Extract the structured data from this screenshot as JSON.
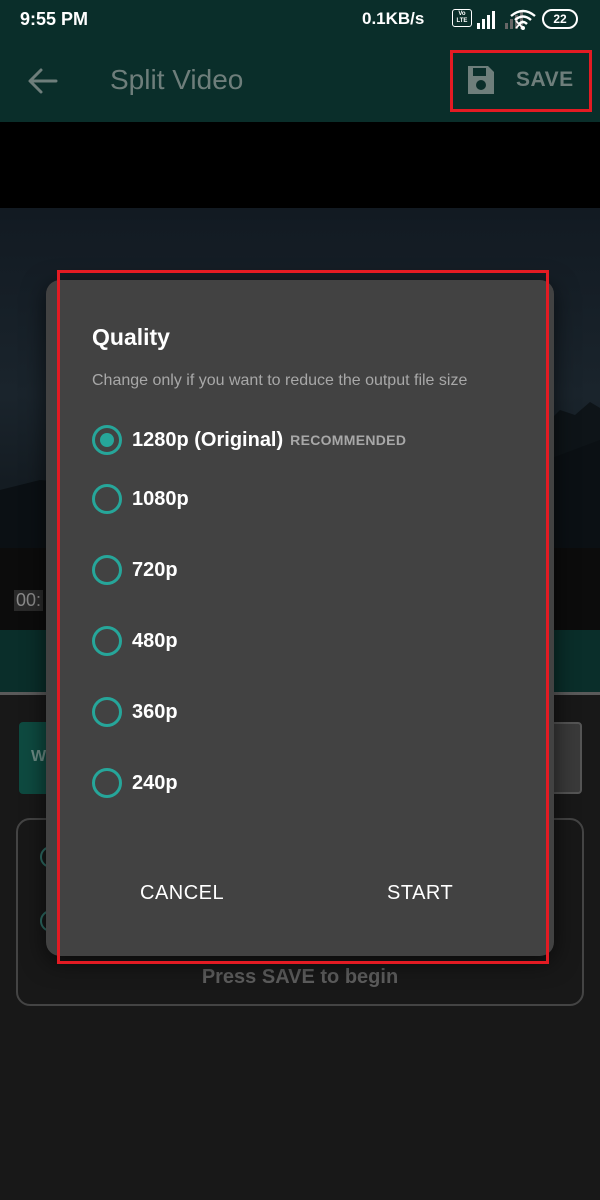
{
  "status_bar": {
    "time": "9:55 PM",
    "speed": "0.1KB/s",
    "volte": "Vo LTE",
    "battery": "22"
  },
  "app_bar": {
    "title": "Split Video",
    "save_label": "SAVE"
  },
  "background": {
    "time_partial": "00:",
    "mode_partial": "W",
    "press_save": "Press SAVE to begin"
  },
  "dialog": {
    "title": "Quality",
    "subtitle": "Change only if you want to reduce the output file size",
    "options": [
      {
        "label": "1280p (Original)",
        "tag": "RECOMMENDED",
        "selected": true
      },
      {
        "label": "1080p",
        "tag": "",
        "selected": false
      },
      {
        "label": "720p",
        "tag": "",
        "selected": false
      },
      {
        "label": "480p",
        "tag": "",
        "selected": false
      },
      {
        "label": "360p",
        "tag": "",
        "selected": false
      },
      {
        "label": "240p",
        "tag": "",
        "selected": false
      }
    ],
    "cancel_label": "CANCEL",
    "start_label": "START"
  },
  "colors": {
    "accent": "#26a69a",
    "app_bar": "#0a2e2a",
    "highlight": "#e31b23",
    "dialog": "#424242"
  }
}
